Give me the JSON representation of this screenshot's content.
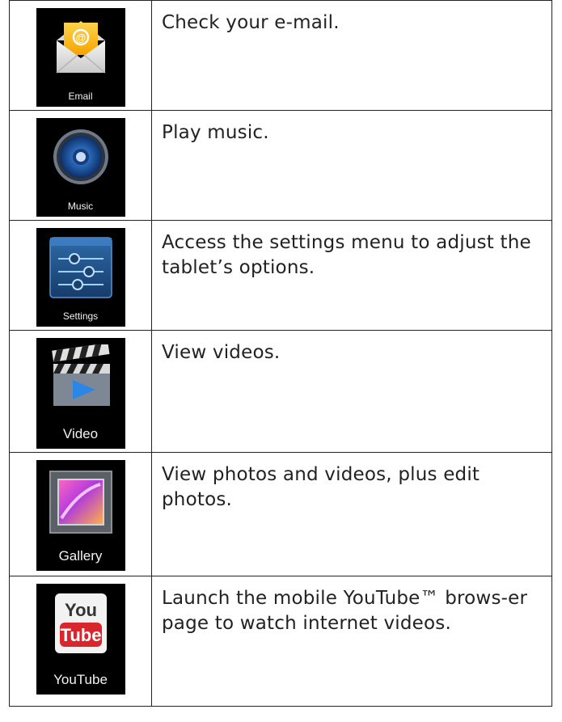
{
  "rows": [
    {
      "icon": "email-icon",
      "label": "Email",
      "description": "Check your e-mail."
    },
    {
      "icon": "music-icon",
      "label": "Music",
      "description": "Play music."
    },
    {
      "icon": "settings-icon",
      "label": "Settings",
      "description": "Access the settings menu to adjust the tablet’s options."
    },
    {
      "icon": "video-icon",
      "label": "Video",
      "description": "View  videos."
    },
    {
      "icon": "gallery-icon",
      "label": "Gallery",
      "description": "View photos and videos, plus edit photos."
    },
    {
      "icon": "youtube-icon",
      "label": "YouTube",
      "description": "Launch the mobile YouTube™ brows-er page to watch internet videos."
    }
  ],
  "youtube_logo": {
    "top": "You",
    "bottom": "Tube"
  }
}
